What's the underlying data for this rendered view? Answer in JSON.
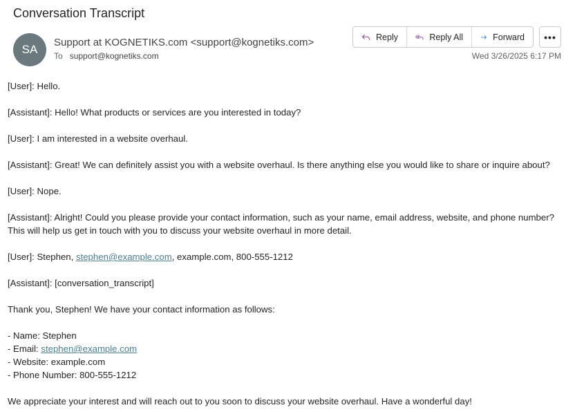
{
  "header": {
    "subject": "Conversation Transcript",
    "avatar_initials": "SA",
    "sender": "Support at KOGNETIKS.com <support@kognetiks.com>",
    "to_label": "To",
    "recipient": "support@kognetiks.com",
    "timestamp": "Wed 3/26/2025 6:17 PM"
  },
  "toolbar": {
    "reply_label": "Reply",
    "reply_all_label": "Reply All",
    "forward_label": "Forward",
    "more_label": "•••",
    "icons": [
      "reply-icon",
      "reply-all-icon",
      "forward-icon",
      "more-options-icon"
    ],
    "icon_colors": {
      "reply": "#8a3fa0",
      "forward": "#0f6cbd"
    }
  },
  "message": {
    "line1": "[User]: Hello.",
    "line2": "[Assistant]: Hello! What products or services are you interested in today?",
    "line3": "[User]: I am interested in a website overhaul.",
    "line4": "[Assistant]: Great! We can definitely assist you with a website overhaul. Is there anything else you would like to share or inquire about?",
    "line5": "[User]: Nope.",
    "line6a": "[Assistant]: Alright! Could you please provide your contact information, such as your name, email address, website, and phone number?",
    "line6b": "This will help us get in touch with you to discuss your website overhaul in more detail.",
    "line7_prefix": "[User]: Stephen, ",
    "line7_email": "stephen@example.com",
    "line7_suffix": ", example.com, 800-555-1212",
    "line8": "[Assistant]: [conversation_transcript]",
    "line9": "Thank you, Stephen! We have your contact information as follows:",
    "detail_name": "- Name: Stephen",
    "detail_email_prefix": "- Email: ",
    "detail_email": "stephen@example.com",
    "detail_website": "- Website: example.com",
    "detail_phone": "- Phone Number: 800-555-1212",
    "closing": "We appreciate your interest and will reach out to you soon to discuss your website overhaul. Have a wonderful day!"
  }
}
